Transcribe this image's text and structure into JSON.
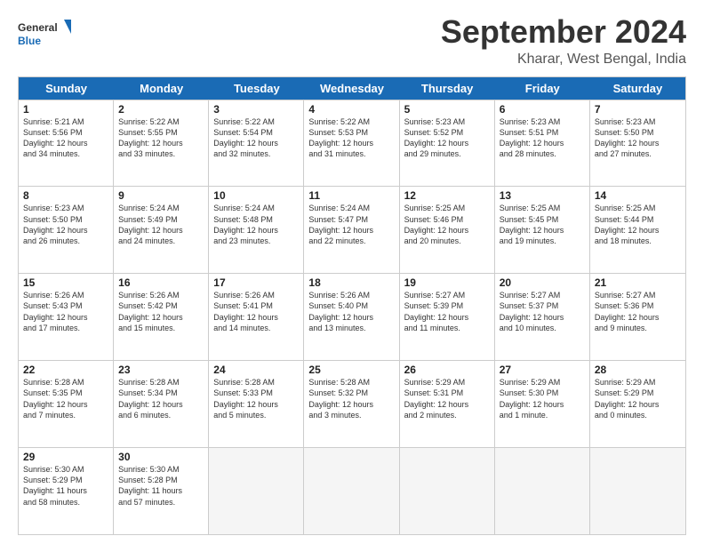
{
  "logo": {
    "text_general": "General",
    "text_blue": "Blue"
  },
  "title": "September 2024",
  "location": "Kharar, West Bengal, India",
  "header_days": [
    "Sunday",
    "Monday",
    "Tuesday",
    "Wednesday",
    "Thursday",
    "Friday",
    "Saturday"
  ],
  "weeks": [
    [
      {
        "day": "1",
        "lines": [
          "Sunrise: 5:21 AM",
          "Sunset: 5:56 PM",
          "Daylight: 12 hours",
          "and 34 minutes."
        ]
      },
      {
        "day": "2",
        "lines": [
          "Sunrise: 5:22 AM",
          "Sunset: 5:55 PM",
          "Daylight: 12 hours",
          "and 33 minutes."
        ]
      },
      {
        "day": "3",
        "lines": [
          "Sunrise: 5:22 AM",
          "Sunset: 5:54 PM",
          "Daylight: 12 hours",
          "and 32 minutes."
        ]
      },
      {
        "day": "4",
        "lines": [
          "Sunrise: 5:22 AM",
          "Sunset: 5:53 PM",
          "Daylight: 12 hours",
          "and 31 minutes."
        ]
      },
      {
        "day": "5",
        "lines": [
          "Sunrise: 5:23 AM",
          "Sunset: 5:52 PM",
          "Daylight: 12 hours",
          "and 29 minutes."
        ]
      },
      {
        "day": "6",
        "lines": [
          "Sunrise: 5:23 AM",
          "Sunset: 5:51 PM",
          "Daylight: 12 hours",
          "and 28 minutes."
        ]
      },
      {
        "day": "7",
        "lines": [
          "Sunrise: 5:23 AM",
          "Sunset: 5:50 PM",
          "Daylight: 12 hours",
          "and 27 minutes."
        ]
      }
    ],
    [
      {
        "day": "8",
        "lines": [
          "Sunrise: 5:23 AM",
          "Sunset: 5:50 PM",
          "Daylight: 12 hours",
          "and 26 minutes."
        ]
      },
      {
        "day": "9",
        "lines": [
          "Sunrise: 5:24 AM",
          "Sunset: 5:49 PM",
          "Daylight: 12 hours",
          "and 24 minutes."
        ]
      },
      {
        "day": "10",
        "lines": [
          "Sunrise: 5:24 AM",
          "Sunset: 5:48 PM",
          "Daylight: 12 hours",
          "and 23 minutes."
        ]
      },
      {
        "day": "11",
        "lines": [
          "Sunrise: 5:24 AM",
          "Sunset: 5:47 PM",
          "Daylight: 12 hours",
          "and 22 minutes."
        ]
      },
      {
        "day": "12",
        "lines": [
          "Sunrise: 5:25 AM",
          "Sunset: 5:46 PM",
          "Daylight: 12 hours",
          "and 20 minutes."
        ]
      },
      {
        "day": "13",
        "lines": [
          "Sunrise: 5:25 AM",
          "Sunset: 5:45 PM",
          "Daylight: 12 hours",
          "and 19 minutes."
        ]
      },
      {
        "day": "14",
        "lines": [
          "Sunrise: 5:25 AM",
          "Sunset: 5:44 PM",
          "Daylight: 12 hours",
          "and 18 minutes."
        ]
      }
    ],
    [
      {
        "day": "15",
        "lines": [
          "Sunrise: 5:26 AM",
          "Sunset: 5:43 PM",
          "Daylight: 12 hours",
          "and 17 minutes."
        ]
      },
      {
        "day": "16",
        "lines": [
          "Sunrise: 5:26 AM",
          "Sunset: 5:42 PM",
          "Daylight: 12 hours",
          "and 15 minutes."
        ]
      },
      {
        "day": "17",
        "lines": [
          "Sunrise: 5:26 AM",
          "Sunset: 5:41 PM",
          "Daylight: 12 hours",
          "and 14 minutes."
        ]
      },
      {
        "day": "18",
        "lines": [
          "Sunrise: 5:26 AM",
          "Sunset: 5:40 PM",
          "Daylight: 12 hours",
          "and 13 minutes."
        ]
      },
      {
        "day": "19",
        "lines": [
          "Sunrise: 5:27 AM",
          "Sunset: 5:39 PM",
          "Daylight: 12 hours",
          "and 11 minutes."
        ]
      },
      {
        "day": "20",
        "lines": [
          "Sunrise: 5:27 AM",
          "Sunset: 5:37 PM",
          "Daylight: 12 hours",
          "and 10 minutes."
        ]
      },
      {
        "day": "21",
        "lines": [
          "Sunrise: 5:27 AM",
          "Sunset: 5:36 PM",
          "Daylight: 12 hours",
          "and 9 minutes."
        ]
      }
    ],
    [
      {
        "day": "22",
        "lines": [
          "Sunrise: 5:28 AM",
          "Sunset: 5:35 PM",
          "Daylight: 12 hours",
          "and 7 minutes."
        ]
      },
      {
        "day": "23",
        "lines": [
          "Sunrise: 5:28 AM",
          "Sunset: 5:34 PM",
          "Daylight: 12 hours",
          "and 6 minutes."
        ]
      },
      {
        "day": "24",
        "lines": [
          "Sunrise: 5:28 AM",
          "Sunset: 5:33 PM",
          "Daylight: 12 hours",
          "and 5 minutes."
        ]
      },
      {
        "day": "25",
        "lines": [
          "Sunrise: 5:28 AM",
          "Sunset: 5:32 PM",
          "Daylight: 12 hours",
          "and 3 minutes."
        ]
      },
      {
        "day": "26",
        "lines": [
          "Sunrise: 5:29 AM",
          "Sunset: 5:31 PM",
          "Daylight: 12 hours",
          "and 2 minutes."
        ]
      },
      {
        "day": "27",
        "lines": [
          "Sunrise: 5:29 AM",
          "Sunset: 5:30 PM",
          "Daylight: 12 hours",
          "and 1 minute."
        ]
      },
      {
        "day": "28",
        "lines": [
          "Sunrise: 5:29 AM",
          "Sunset: 5:29 PM",
          "Daylight: 12 hours",
          "and 0 minutes."
        ]
      }
    ],
    [
      {
        "day": "29",
        "lines": [
          "Sunrise: 5:30 AM",
          "Sunset: 5:29 PM",
          "Daylight: 11 hours",
          "and 58 minutes."
        ]
      },
      {
        "day": "30",
        "lines": [
          "Sunrise: 5:30 AM",
          "Sunset: 5:28 PM",
          "Daylight: 11 hours",
          "and 57 minutes."
        ]
      },
      {
        "day": "",
        "lines": []
      },
      {
        "day": "",
        "lines": []
      },
      {
        "day": "",
        "lines": []
      },
      {
        "day": "",
        "lines": []
      },
      {
        "day": "",
        "lines": []
      }
    ]
  ]
}
